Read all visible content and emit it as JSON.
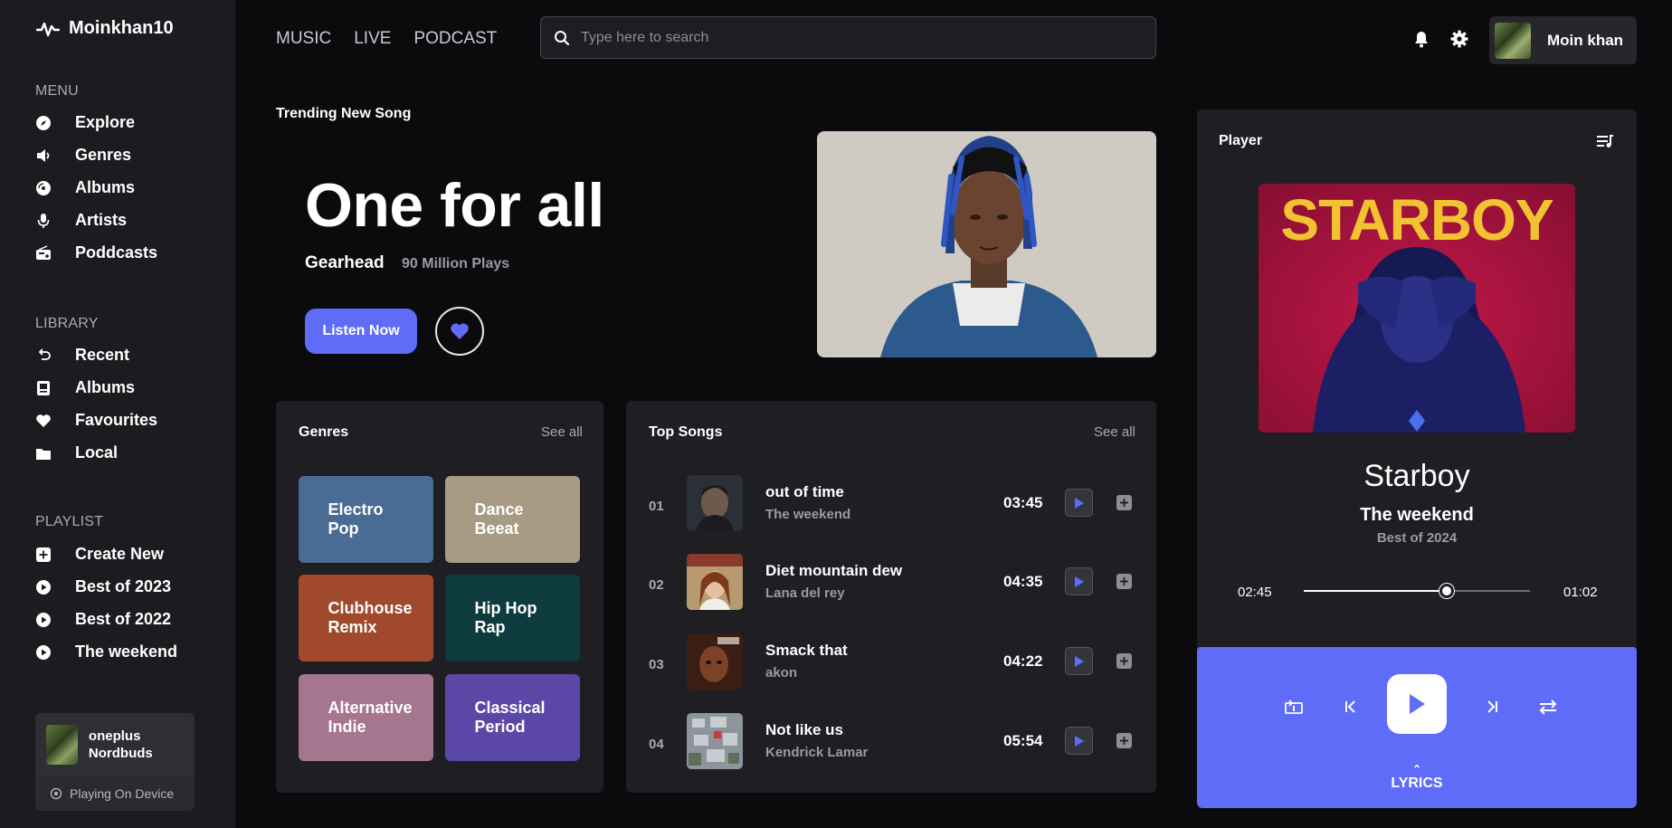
{
  "app": {
    "brand": "Moinkhan10"
  },
  "sidebar": {
    "menu_title": "MENU",
    "menu": [
      {
        "label": "Explore",
        "icon": "compass-icon"
      },
      {
        "label": "Genres",
        "icon": "speaker-icon"
      },
      {
        "label": "Albums",
        "icon": "disc-icon"
      },
      {
        "label": "Artists",
        "icon": "microphone-icon"
      },
      {
        "label": "Poddcasts",
        "icon": "radio-icon"
      }
    ],
    "library_title": "LIBRARY",
    "library": [
      {
        "label": "Recent",
        "icon": "undo-icon"
      },
      {
        "label": "Albums",
        "icon": "album-icon"
      },
      {
        "label": "Favourites",
        "icon": "heart-icon"
      },
      {
        "label": "Local",
        "icon": "folder-icon"
      }
    ],
    "playlist_title": "PLAYLIST",
    "playlist": [
      {
        "label": "Create New",
        "icon": "plus-square-icon"
      },
      {
        "label": "Best of 2023",
        "icon": "play-circle-icon"
      },
      {
        "label": "Best of 2022",
        "icon": "play-circle-icon"
      },
      {
        "label": "The weekend",
        "icon": "play-circle-icon"
      }
    ],
    "device": {
      "name": "oneplus Nordbuds",
      "status": "Playing On Device"
    }
  },
  "topbar": {
    "nav": [
      "MUSIC",
      "LIVE",
      "PODCAST"
    ],
    "search_placeholder": "Type here to search",
    "user_name": "Moin khan"
  },
  "hero": {
    "label": "Trending New Song",
    "title": "One for all",
    "artist": "Gearhead",
    "plays": "90 Million Plays",
    "listen_label": "Listen Now"
  },
  "genres": {
    "title": "Genres",
    "see_all": "See all",
    "items": [
      {
        "label": "Electro Pop",
        "color": "#4a6b93"
      },
      {
        "label": "Dance Beeat",
        "color": "#a89b84"
      },
      {
        "label": "Clubhouse Remix",
        "color": "#a0492d"
      },
      {
        "label": "Hip Hop Rap",
        "color": "#0e3b3d"
      },
      {
        "label": "Alternative Indie",
        "color": "#a6758f"
      },
      {
        "label": "Classical Period",
        "color": "#5b48a6"
      }
    ]
  },
  "top_songs": {
    "title": "Top Songs",
    "see_all": "See all",
    "songs": [
      {
        "num": "01",
        "title": "out of time",
        "artist": "The weekend",
        "duration": "03:45"
      },
      {
        "num": "02",
        "title": "Diet mountain dew",
        "artist": "Lana del rey",
        "duration": "04:35"
      },
      {
        "num": "03",
        "title": "Smack that",
        "artist": "akon",
        "duration": "04:22"
      },
      {
        "num": "04",
        "title": "Not like us",
        "artist": "Kendrick Lamar",
        "duration": "05:54"
      }
    ]
  },
  "player": {
    "label": "Player",
    "cover_text": "STARBOY",
    "title": "Starboy",
    "artist": "The weekend",
    "album": "Best of 2024",
    "elapsed": "02:45",
    "remaining": "01:02",
    "progress": 0.63,
    "lyrics_label": "LYRICS",
    "accent": "#5f6cf7"
  }
}
